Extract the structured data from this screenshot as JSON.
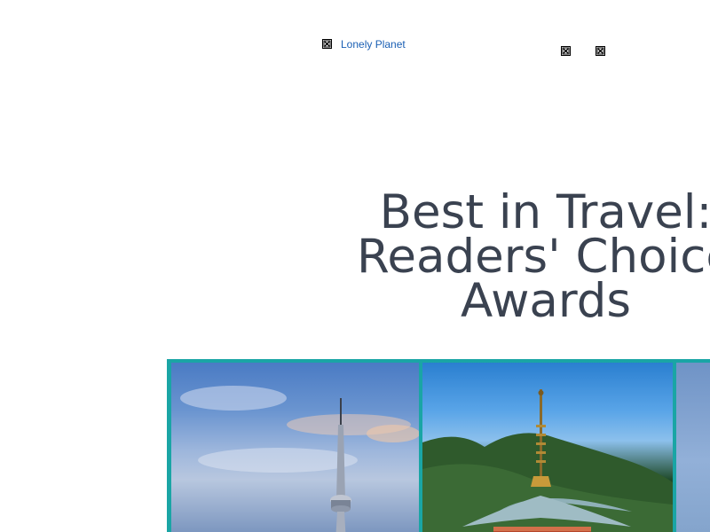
{
  "header": {
    "logo_link_text": "Lonely Planet"
  },
  "hero": {
    "title_lines": [
      "Best in Travel:",
      "Readers' Choice",
      "Awards"
    ]
  },
  "icons": {
    "broken_image": "broken-image-icon"
  },
  "colors": {
    "link": "#1a5fb4",
    "headline": "#3a4250",
    "gallery_border": "#1aa5a5"
  }
}
